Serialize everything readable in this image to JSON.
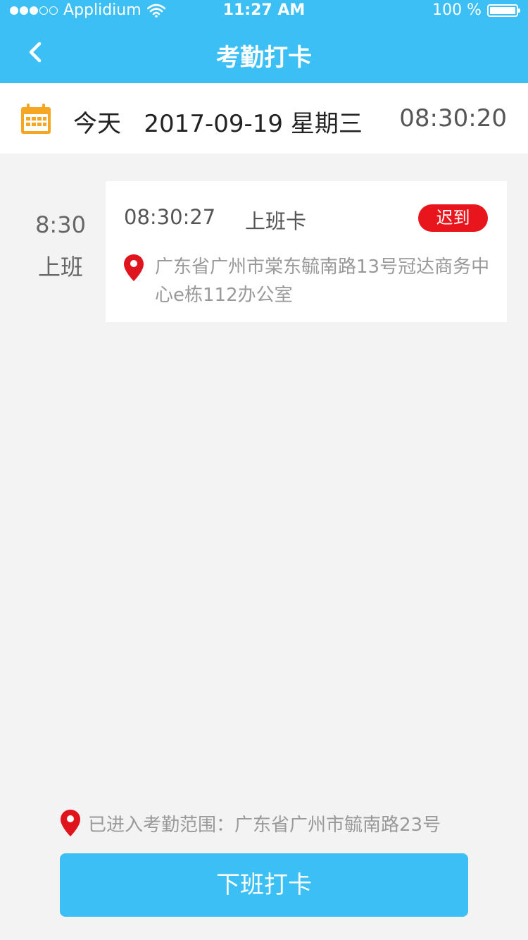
{
  "status_bar": {
    "carrier": "Applidium",
    "time": "11:27 AM",
    "battery": "100 %",
    "signal_dots_filled": 3,
    "signal_dots_total": 5
  },
  "nav": {
    "title": "考勤打卡",
    "back_icon": "chevron-left-icon"
  },
  "date_bar": {
    "calendar_icon": "calendar-icon",
    "date": "今天   2017-09-19 星期三",
    "clock": "08:30:20"
  },
  "record": {
    "scheduled_time": "8:30",
    "label": "上班",
    "punch_time": "08:30:27",
    "punch_type": "上班卡",
    "status_badge": "迟到",
    "address": "广东省广州市棠东毓南路13号冠达商务中心e栋112办公室"
  },
  "footer": {
    "geo_status": "已进入考勤范围：广东省广州市毓南路23号",
    "action_button": "下班打卡"
  },
  "colors": {
    "accent": "#3cbff5",
    "late_badge": "#e8161c",
    "pin": "#e0141c",
    "calendar": "#f5a623"
  }
}
